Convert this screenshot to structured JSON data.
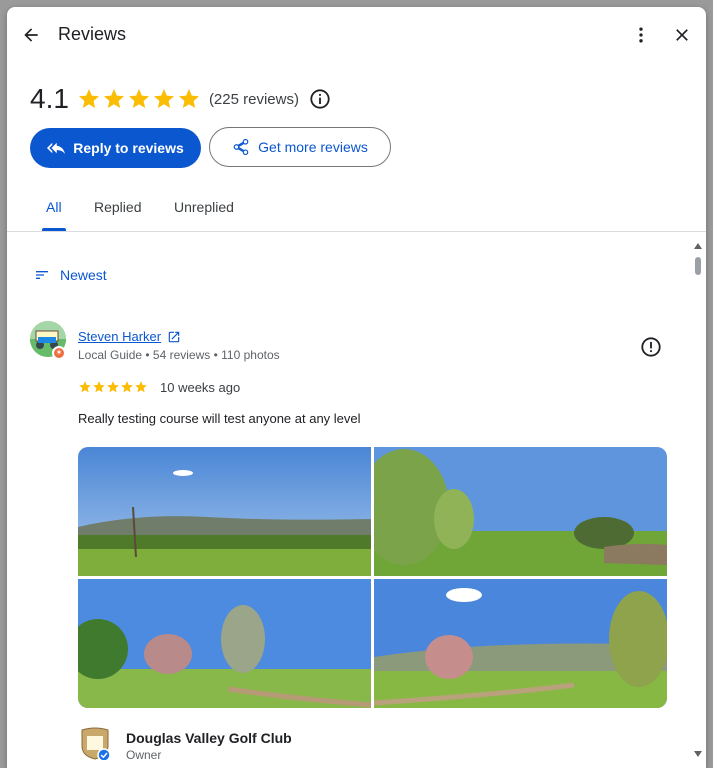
{
  "header": {
    "title": "Reviews",
    "back_icon": "arrow-back-icon",
    "more_icon": "more-vert-icon",
    "close_icon": "close-icon"
  },
  "summary": {
    "rating": "4.1",
    "stars": 5,
    "count": "(225 reviews)",
    "info_icon": "info-icon",
    "star_color": "#fbbc04"
  },
  "actions": {
    "reply_label": "Reply to reviews",
    "more_label": "Get more reviews",
    "primary_color": "#0b57d0"
  },
  "tabs": [
    {
      "label": "All",
      "active": true
    },
    {
      "label": "Replied",
      "active": false
    },
    {
      "label": "Unreplied",
      "active": false
    }
  ],
  "sort": {
    "label": "Newest"
  },
  "review": {
    "author": "Steven Harker",
    "meta": "Local Guide • 54 reviews • 110 photos",
    "rating": 5,
    "time": "10 weeks ago",
    "text": "Really testing course will test anyone at any level",
    "photo_count": 4
  },
  "owner": {
    "name": "Douglas Valley Golf Club",
    "role": "Owner",
    "verified": true
  }
}
